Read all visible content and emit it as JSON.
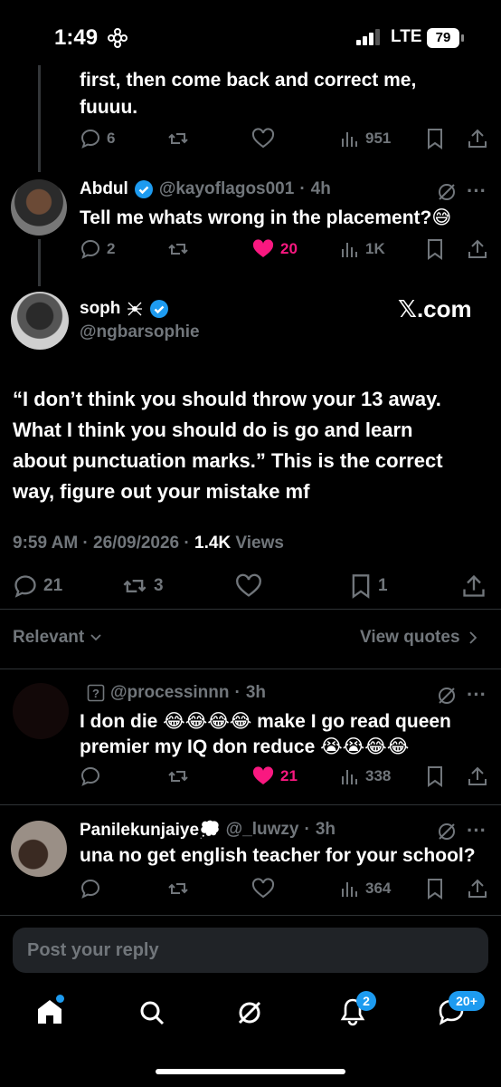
{
  "status_bar": {
    "time": "1:49",
    "network": "LTE",
    "battery": "79"
  },
  "post_top": {
    "text_line1": "first, then come back and correct me,",
    "text_line2": "fuuuu.",
    "replies": "6",
    "reposts": "",
    "likes": "",
    "views": "951"
  },
  "reply1": {
    "name": "Abdul",
    "handle": "@kayoflagos001",
    "time": "4h",
    "text": "Tell me whats wrong in the placement?😅",
    "replies": "2",
    "likes": "20",
    "views": "1K"
  },
  "main_post": {
    "name": "soph",
    "handle": "@ngbarsophie",
    "watermark": "𝕏.com",
    "text_lines": [
      "“I don’t think you should throw your 13 away.",
      "What I think you should do is go and learn",
      "about punctuation marks.” This is the correct",
      "way, figure out your mistake mf"
    ],
    "meta_time": "9:59 AM · 26/09/2026 · ",
    "views_count": "1.4K",
    "views_label": " Views",
    "replies": "21",
    "reposts": "3",
    "likes": "",
    "bookmarks": "1"
  },
  "sort": {
    "label": "Relevant",
    "view_quotes": "View quotes"
  },
  "reply2": {
    "handle": "@processinnn",
    "time": "3h",
    "text_line1": "I don die 😂😂😂😂 make I go read queen",
    "text_line2": "premier my IQ don reduce 😭😭😂😂",
    "replies": "",
    "likes": "21",
    "views": "338"
  },
  "reply3": {
    "name": "Panilekunjaiye💭",
    "handle": "@_luwzy",
    "time": "3h",
    "text": "una no get english teacher for your school?",
    "views": "364"
  },
  "composer": {
    "placeholder": "Post your reply"
  },
  "tab_bar": {
    "notifications_badge": "2",
    "messages_badge": "20+"
  },
  "colors": {
    "accent": "#1d9bf0",
    "like": "#f91880",
    "muted": "#71767b",
    "background": "#000000"
  }
}
